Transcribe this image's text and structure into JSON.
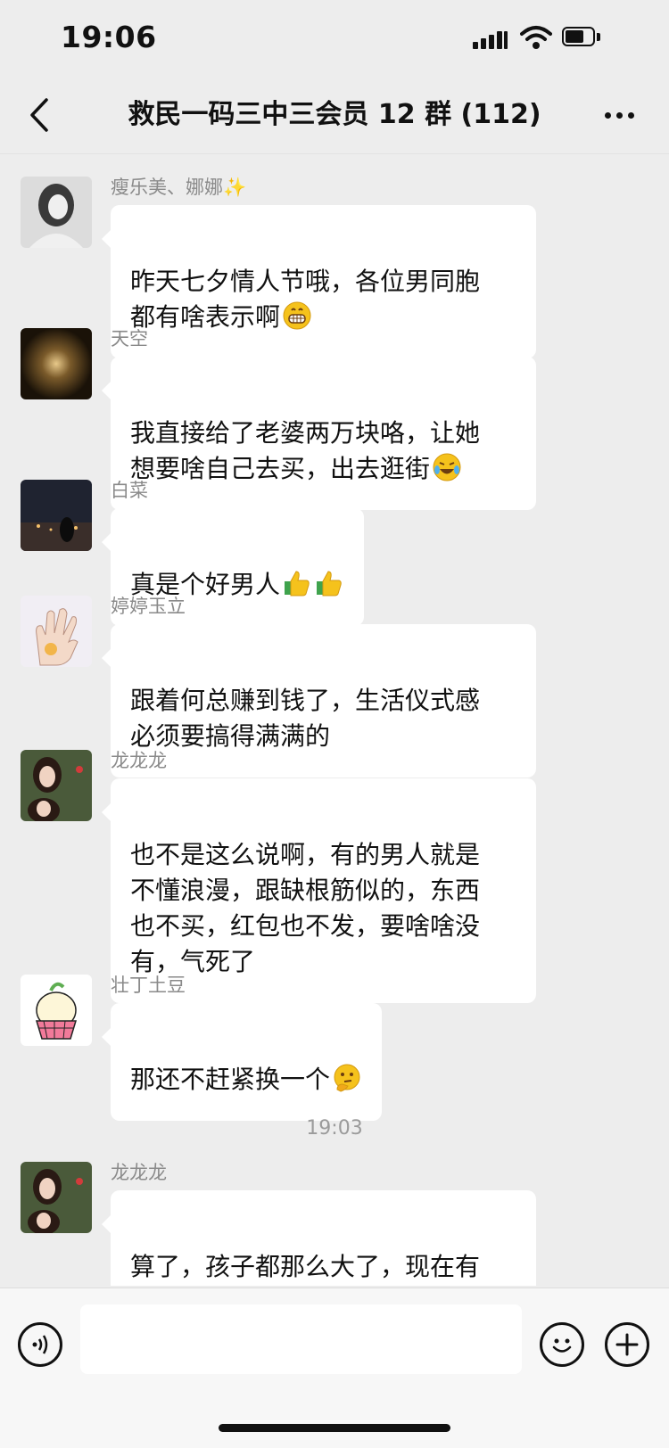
{
  "status": {
    "time": "19:06"
  },
  "header": {
    "title": "救民一码三中三会员 12 群 (112)"
  },
  "messages": [
    {
      "sender": "瘦乐美、娜娜",
      "text": "昨天七夕情人节哦，各位男同胞\n都有啥表示啊",
      "emoji": "grin-emoji"
    },
    {
      "sender": "天空",
      "text": "我直接给了老婆两万块咯，让她\n想要啥自己去买，出去逛街",
      "emoji": "laugh-cry-emoji"
    },
    {
      "sender": "白菜",
      "text": "真是个好男人",
      "emoji": "thumbs-up-emoji"
    },
    {
      "sender": "婷婷玉立",
      "text": "跟着何总赚到钱了，生活仪式感\n必须要搞得满满的"
    },
    {
      "sender": "龙龙龙",
      "text": "也不是这么说啊，有的男人就是\n不懂浪漫，跟缺根筋似的，东西\n也不买，红包也不发，要啥啥没\n有，气死了"
    },
    {
      "sender": "壮丁土豆",
      "text": "那还不赶紧换一个",
      "emoji": "thinking-emoji"
    },
    {
      "sender": "龙龙龙",
      "text": "算了，孩子都那么大了，现在有\n何总的资料，老娘自己能挣钱"
    }
  ],
  "time_divider": "19:03",
  "input": {
    "placeholder": ""
  }
}
